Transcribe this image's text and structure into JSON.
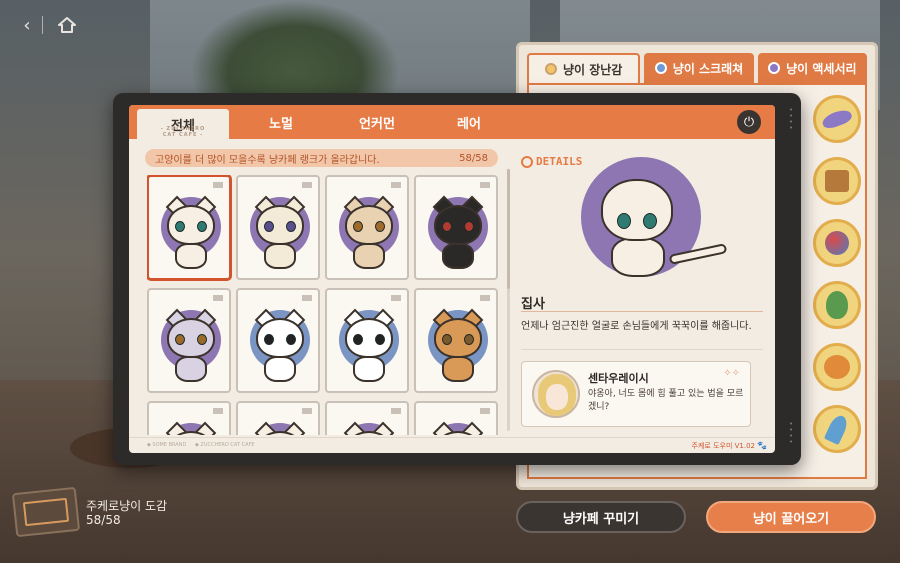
{
  "nav": {
    "back_glyph": "‹"
  },
  "dialog": {
    "tabs": [
      {
        "label": "전체",
        "sub": "- ZUCCHERO CAT CAFE -"
      },
      {
        "label": "노멀"
      },
      {
        "label": "언커먼"
      },
      {
        "label": "레어"
      }
    ],
    "power_glyph": "⏻",
    "info_text": "고양이를 더 많이 모을수록 냥카페 랭크가 올라갑니다.",
    "info_count": "58/58",
    "details_logo": "DETAILS",
    "selected_cat": {
      "name": "집사",
      "description": "언제나 엄근진한 얼굴로 손님들에게 꾹꾹이를 해줍니다."
    },
    "comment": {
      "commenter": "센타우레이시",
      "quote": "야옹아, 너도 몸에 힘 풀고 있는 법을 모르겠니?",
      "sparkle": "✧✧"
    },
    "footer": {
      "left1": "◆ SOME BRAND",
      "left2": "◆ ZUCCHERO CAT CAFE",
      "version": "주케로 도우미 V1.02",
      "paw": "🐾"
    },
    "colors": {
      "accent": "#e67b45",
      "selected_border": "#d2542f",
      "purple_bg": "#8d76b2",
      "blue_bg": "#7a95c4"
    }
  },
  "cards": [
    {
      "id": "1",
      "bg": "purple",
      "fur": "#f7efe3",
      "eye": "#2f7b72",
      "selected": true
    },
    {
      "id": "2",
      "bg": "purple",
      "fur": "#f4ead8",
      "eye": "#5a4f8c",
      "selected": false
    },
    {
      "id": "3",
      "bg": "purple",
      "fur": "#e8d2b2",
      "eye": "#a06a2a",
      "selected": false
    },
    {
      "id": "4",
      "bg": "purple",
      "fur": "#2b2828",
      "eye": "#b23a30",
      "selected": false
    },
    {
      "id": "5",
      "bg": "purple",
      "fur": "#d8d2e2",
      "eye": "#9a6a2a",
      "selected": false
    },
    {
      "id": "6",
      "bg": "blue",
      "fur": "#ffffff",
      "eye": "#222222",
      "selected": false
    },
    {
      "id": "7",
      "bg": "blue",
      "fur": "#ffffff",
      "eye": "#222222",
      "selected": false
    },
    {
      "id": "8",
      "bg": "blue",
      "fur": "#d99a58",
      "eye": "#7a5a2a",
      "selected": false
    }
  ],
  "side_panel": {
    "tabs": [
      {
        "label": "냥이 장난감",
        "active": true
      },
      {
        "label": "냥이 스크래쳐",
        "active": false
      },
      {
        "label": "냥이 액세서리",
        "active": false
      }
    ],
    "toys": [
      {
        "icon": "dolphin-toy-icon",
        "color": "#8c79c6"
      },
      {
        "icon": "box-toy-icon",
        "color": "#b5793c"
      },
      {
        "icon": "ball-toy-icon",
        "color": "#4f7ec0"
      },
      {
        "icon": "leaf-toy-icon",
        "color": "#5a9a4e"
      },
      {
        "icon": "fruit-toy-icon",
        "color": "#e08a3a"
      },
      {
        "icon": "feather-toy-icon",
        "color": "#5fa0d0"
      }
    ]
  },
  "buttons": {
    "decorate": "냥카페 꾸미기",
    "bring": "냥이 끌어오기"
  },
  "collection": {
    "title": "주케로냥이 도감",
    "count": "58/58"
  }
}
